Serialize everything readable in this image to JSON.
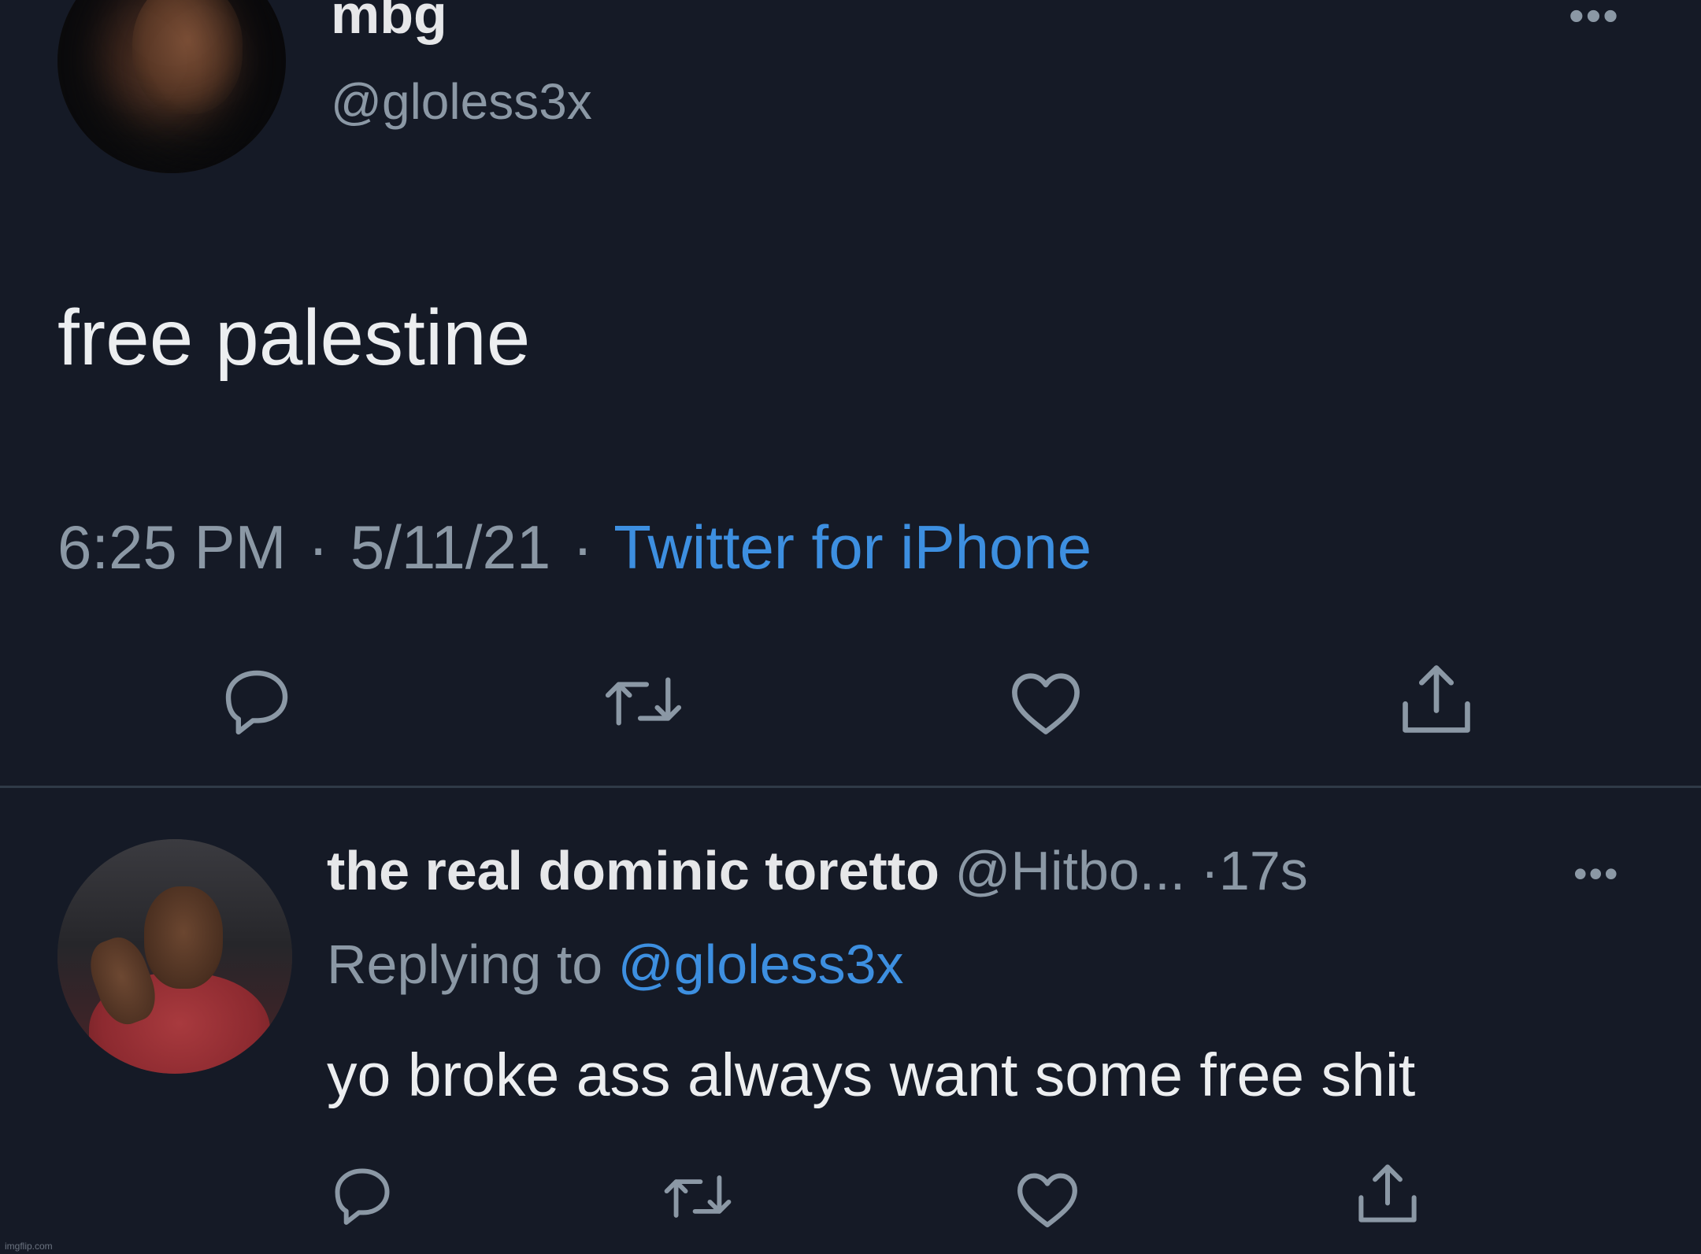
{
  "tweet": {
    "display_name": "mbg",
    "handle": "@gloless3x",
    "text": "free palestine",
    "time": "6:25 PM",
    "date": "5/11/21",
    "source": "Twitter for iPhone",
    "separator": "·",
    "more_icon": "more-horizontal-icon",
    "more_glyph": "•••"
  },
  "reply": {
    "display_name": "the real dominic toretto",
    "handle": "@Hitbo...",
    "time": "·17s",
    "replying_prefix": "Replying to",
    "replying_to": "@gloless3x",
    "text": "yo broke ass always want some free shit",
    "more_glyph": "•••"
  },
  "actions": [
    "reply-icon",
    "retweet-icon",
    "like-icon",
    "share-icon"
  ],
  "watermark": "imgflip.com",
  "colors": {
    "background": "#151a26",
    "text": "#e6e7e9",
    "secondary": "#8b98a5",
    "accent": "#3d8fe0",
    "divider": "#2f3a47"
  }
}
